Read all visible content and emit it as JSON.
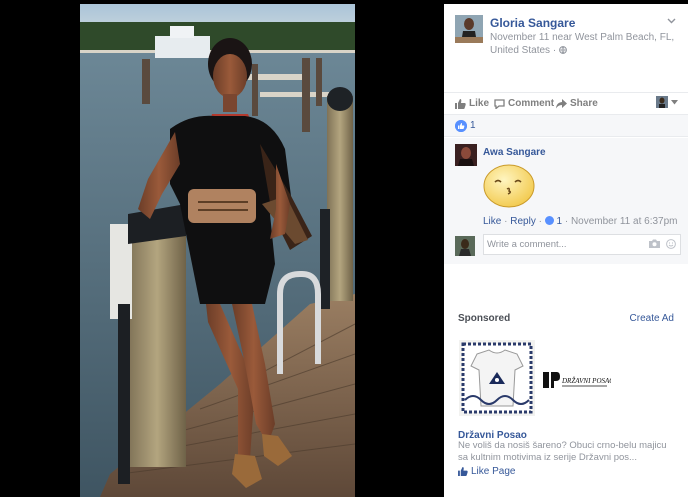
{
  "post": {
    "author": "Gloria Sangare",
    "meta": "November 11 near West Palm Beach, FL, United States · "
  },
  "actions": {
    "like": "Like",
    "comment": "Comment",
    "share": "Share"
  },
  "reactions": {
    "count": "1"
  },
  "comment": {
    "author": "Awa Sangare",
    "like": "Like",
    "sep1": " · ",
    "reply": "Reply",
    "sep2": " · ",
    "likes": "1",
    "time": " · November 11 at 6:37pm"
  },
  "composer": {
    "placeholder": "Write a comment..."
  },
  "sponsored": {
    "label": "Sponsored",
    "create_ad": "Create Ad",
    "title": "Državni Posao",
    "description": "Ne voliš da nosiš šareno? Obuci crno-belu majicu sa kultnim motivima iz serije Državni pos...",
    "like_page": "Like Page",
    "logo_text": "DRŽAVNI POSAO"
  },
  "colors": {
    "link": "#365899",
    "meta": "#90949c",
    "like_blue": "#5890ff",
    "panel_bg": "#ffffff",
    "comment_bg": "#f6f7f9"
  },
  "icons": [
    "thumb-up-icon",
    "speech-bubble-icon",
    "share-arrow-icon",
    "globe-icon",
    "chevron-down-icon",
    "camera-icon",
    "smiley-icon"
  ]
}
